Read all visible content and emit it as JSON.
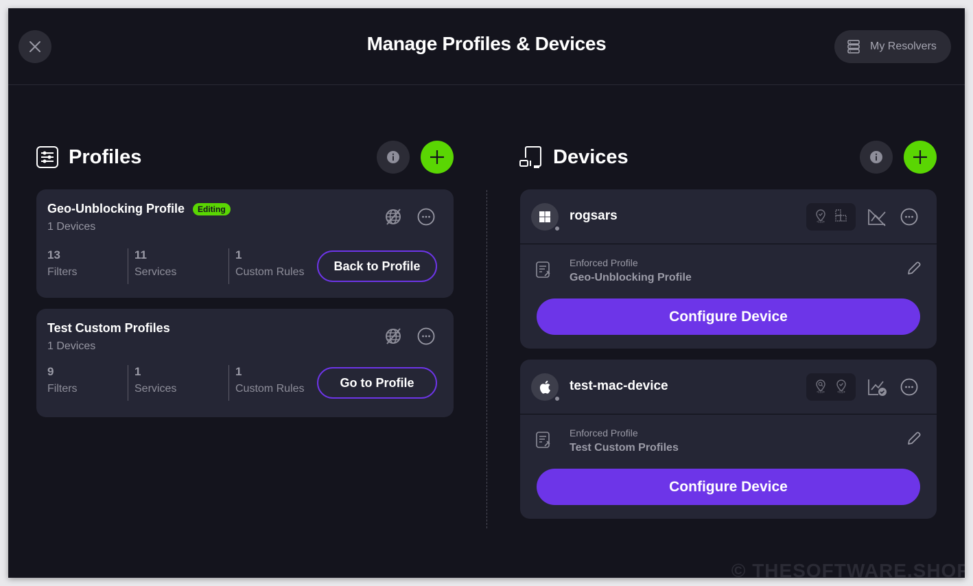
{
  "header": {
    "title": "Manage Profiles & Devices",
    "resolvers_label": "My Resolvers"
  },
  "profiles_section": {
    "title": "Profiles",
    "items": [
      {
        "name": "Geo-Unblocking Profile",
        "badge": "Editing",
        "devices": "1 Devices",
        "stats": [
          {
            "value": "13",
            "label": "Filters"
          },
          {
            "value": "11",
            "label": "Services"
          },
          {
            "value": "1",
            "label": "Custom Rules"
          }
        ],
        "action_label": "Back to Profile"
      },
      {
        "name": "Test Custom Profiles",
        "badge": null,
        "devices": "1 Devices",
        "stats": [
          {
            "value": "9",
            "label": "Filters"
          },
          {
            "value": "1",
            "label": "Services"
          },
          {
            "value": "1",
            "label": "Custom Rules"
          }
        ],
        "action_label": "Go to Profile"
      }
    ]
  },
  "devices_section": {
    "title": "Devices",
    "items": [
      {
        "name": "rogsars",
        "os_icon": "windows-icon",
        "enforced_label": "Enforced Profile",
        "enforced_profile": "Geo-Unblocking Profile",
        "analytics": "disabled",
        "configure_label": "Configure Device"
      },
      {
        "name": "test-mac-device",
        "os_icon": "apple-icon",
        "enforced_label": "Enforced Profile",
        "enforced_profile": "Test Custom Profiles",
        "analytics": "enabled",
        "configure_label": "Configure Device"
      }
    ]
  },
  "colors": {
    "accent_green": "#5ad603",
    "accent_purple": "#6d35e8",
    "background": "#14141d",
    "card": "#252635"
  },
  "watermark": "© THESOFTWARE.SHOP"
}
